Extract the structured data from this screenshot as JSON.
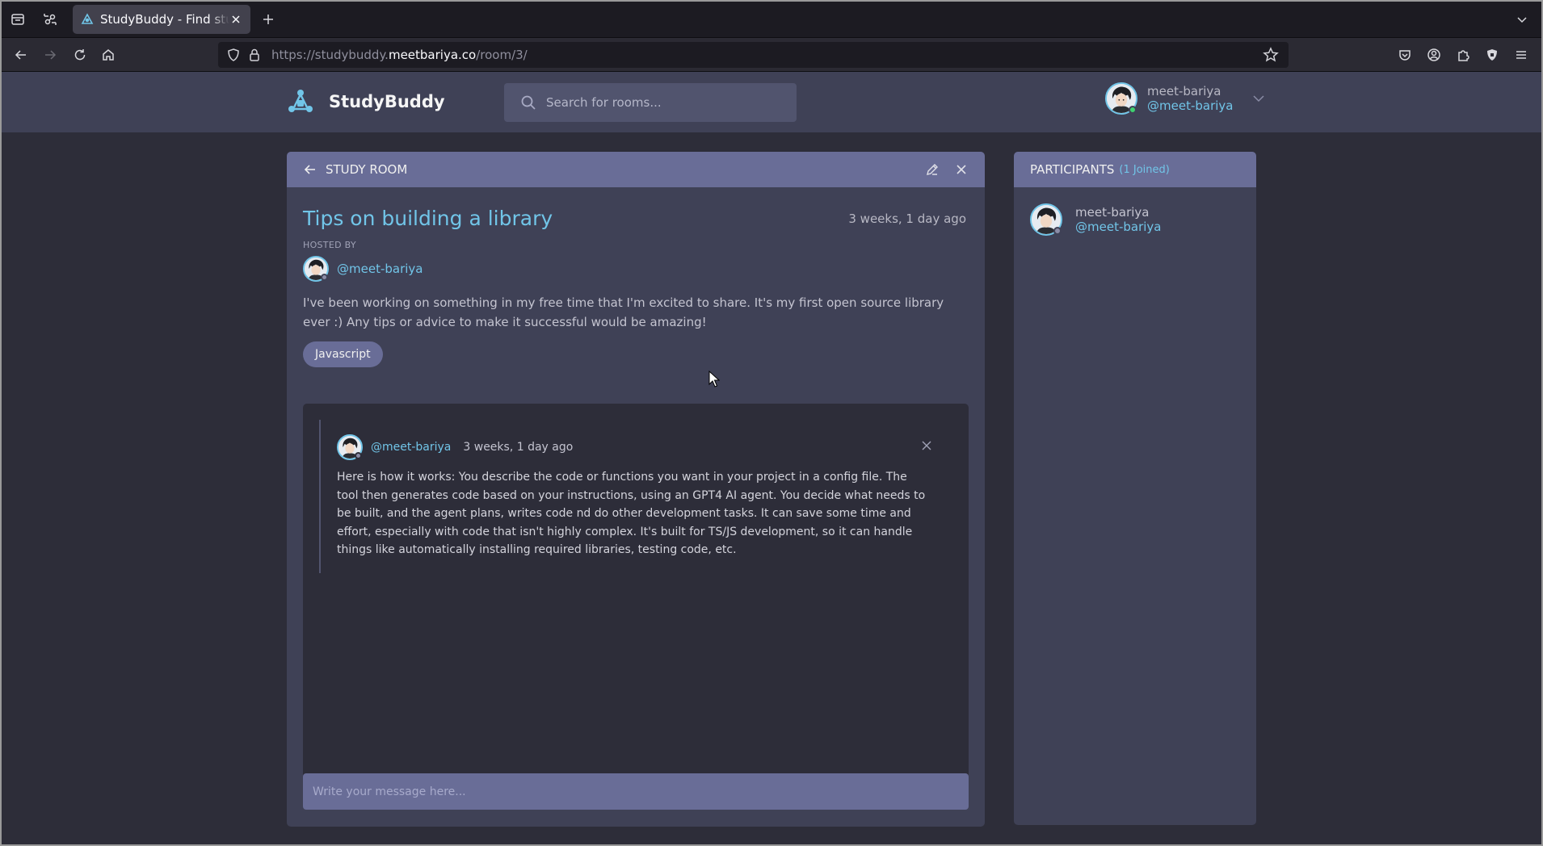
{
  "browser": {
    "tab_title": "StudyBuddy - Find study partners",
    "url_prefix": "https://studybuddy.",
    "url_host": "meetbariya.co",
    "url_path": "/room/3/"
  },
  "header": {
    "brand": "StudyBuddy",
    "search_placeholder": "Search for rooms...",
    "user_name": "meet-bariya",
    "user_handle": "@meet-bariya",
    "online_color": "#3ed16f"
  },
  "room": {
    "header_label": "Study Room",
    "title": "Tips on building a library",
    "created": "3 weeks, 1 day ago",
    "hosted_by_label": "Hosted By",
    "host_handle": "@meet-bariya",
    "description": "I've been working on something in my free time that I'm excited to share. It's my first open source library ever :) Any tips or advice to make it successful would be amazing!",
    "topic": "Javascript"
  },
  "messages": [
    {
      "handle": "@meet-bariya",
      "time": "3 weeks, 1 day ago",
      "body": "Here is how it works: You describe the code or functions you want in your project in a config file. The tool then generates code based on your instructions, using an GPT4 AI agent. You decide what needs to be built, and the agent plans, writes code nd do other development tasks. It can save some time and effort, especially with code that isn't highly complex. It's built for TS/JS development, so it can handle things like automatically installing required libraries, testing code, etc."
    }
  ],
  "composer": {
    "placeholder": "Write your message here..."
  },
  "participants": {
    "label": "Participants",
    "count_label": "(1 Joined)",
    "items": [
      {
        "name": "meet-bariya",
        "handle": "@meet-bariya"
      }
    ]
  },
  "colors": {
    "accent": "#71c5e8",
    "panel": "#3f4156",
    "panel_header": "#696d97",
    "background": "#2d2d39"
  }
}
